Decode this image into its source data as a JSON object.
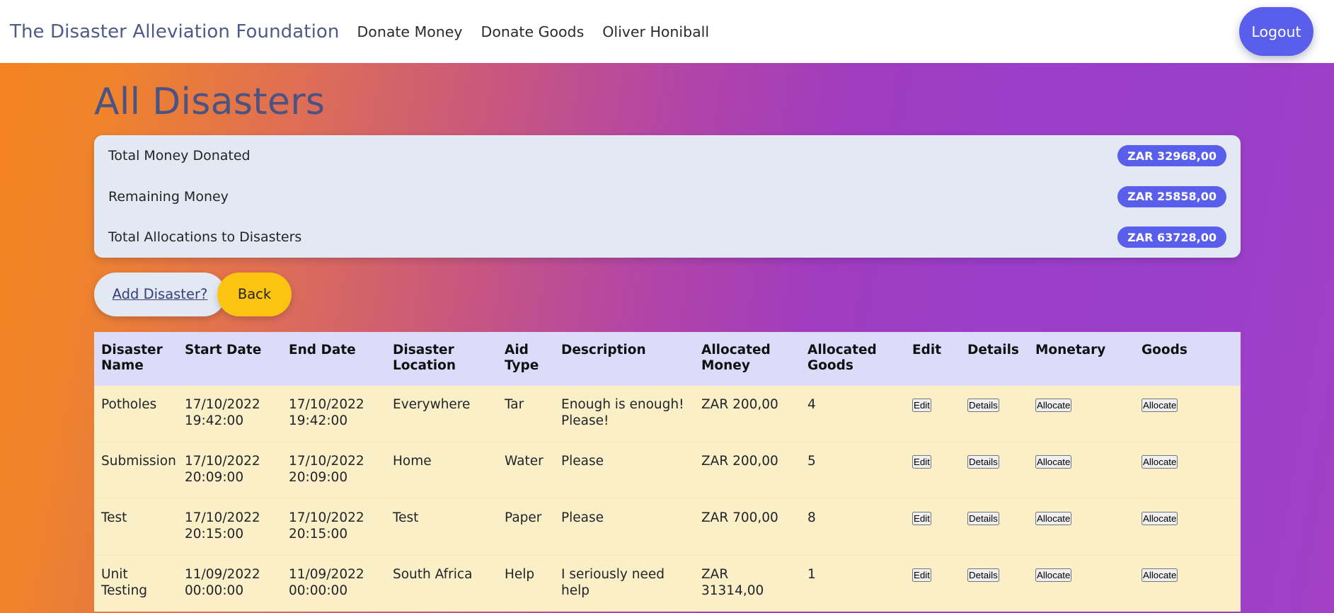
{
  "navbar": {
    "brand": "The Disaster Alleviation Foundation",
    "links": [
      {
        "label": "Donate Money",
        "name": "nav-link-donate-money"
      },
      {
        "label": "Donate Goods",
        "name": "nav-link-donate-goods"
      },
      {
        "label": "Oliver Honiball",
        "name": "nav-link-user"
      }
    ],
    "logout_label": "Logout"
  },
  "page": {
    "title": "All Disasters"
  },
  "summary": {
    "rows": [
      {
        "label": "Total Money Donated",
        "value": "ZAR 32968,00"
      },
      {
        "label": "Remaining Money",
        "value": "ZAR 25858,00"
      },
      {
        "label": "Total Allocations to Disasters",
        "value": "ZAR 63728,00"
      }
    ]
  },
  "actions": {
    "add_label": "Add Disaster?",
    "back_label": "Back"
  },
  "table": {
    "headers": [
      "Disaster Name",
      "Start Date",
      "End Date",
      "Disaster Location",
      "Aid Type",
      "Description",
      "Allocated Money",
      "Allocated Goods",
      "Edit",
      "Details",
      "Monetary",
      "Goods"
    ],
    "row_action_labels": {
      "edit": "Edit",
      "details": "Details",
      "monetary": "Allocate",
      "goods": "Allocate"
    },
    "rows": [
      {
        "name": "Potholes",
        "start_date": "17/10/2022 19:42:00",
        "end_date": "17/10/2022 19:42:00",
        "location": "Everywhere",
        "aid_type": "Tar",
        "description": "Enough is enough! Please!",
        "allocated_money": "ZAR 200,00",
        "allocated_goods": "4"
      },
      {
        "name": "Submission",
        "start_date": "17/10/2022 20:09:00",
        "end_date": "17/10/2022 20:09:00",
        "location": "Home",
        "aid_type": "Water",
        "description": "Please",
        "allocated_money": "ZAR 200,00",
        "allocated_goods": "5"
      },
      {
        "name": "Test",
        "start_date": "17/10/2022 20:15:00",
        "end_date": "17/10/2022 20:15:00",
        "location": "Test",
        "aid_type": "Paper",
        "description": "Please",
        "allocated_money": "ZAR 700,00",
        "allocated_goods": "8"
      },
      {
        "name": "Unit Testing",
        "start_date": "11/09/2022 00:00:00",
        "end_date": "11/09/2022 00:00:00",
        "location": "South Africa",
        "aid_type": "Help",
        "description": "I seriously need help",
        "allocated_money": "ZAR 31314,00",
        "allocated_goods": "1"
      }
    ]
  },
  "colors": {
    "accent_blue": "#5A5FEB",
    "accent_amber": "#FCC311",
    "card_bg": "#E3E9F2",
    "table_head_bg": "#DCDCFA",
    "table_row_bg": "#FBEFC8",
    "title_text": "#4A5382",
    "gradient_start": "#F5821F",
    "gradient_end": "#9B3EC8"
  }
}
